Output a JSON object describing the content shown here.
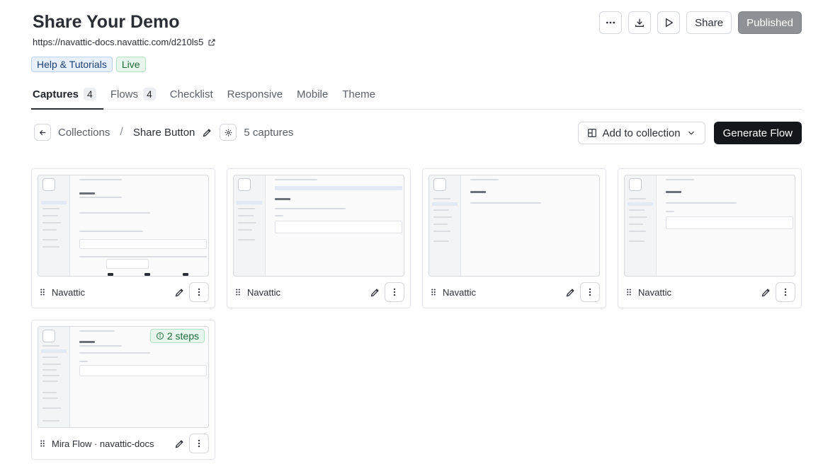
{
  "header": {
    "title": "Share Your Demo",
    "url": "https://navattic-docs.navattic.com/d210ls5",
    "tags": [
      "Help & Tutorials",
      "Live"
    ]
  },
  "actions": {
    "more_icon": "more-horizontal-icon",
    "download_icon": "download-icon",
    "play_icon": "play-icon",
    "share_label": "Share",
    "published_label": "Published"
  },
  "tabs": [
    {
      "label": "Captures",
      "count": "4",
      "active": true
    },
    {
      "label": "Flows",
      "count": "4"
    },
    {
      "label": "Checklist"
    },
    {
      "label": "Responsive"
    },
    {
      "label": "Mobile"
    },
    {
      "label": "Theme"
    }
  ],
  "breadcrumb": {
    "parent": "Collections",
    "separator": "/",
    "current": "Share Button",
    "captures_count": "5 captures"
  },
  "toolbar": {
    "add_to_collection": "Add to collection",
    "generate_flow": "Generate Flow"
  },
  "cards": [
    {
      "name": "Navattic"
    },
    {
      "name": "Navattic"
    },
    {
      "name": "Navattic"
    },
    {
      "name": "Navattic"
    },
    {
      "name": "Mira Flow · navattic-docs",
      "badge": "2 steps"
    }
  ],
  "colors": {
    "primary_button": "#13171c",
    "published_button": "#8e9196",
    "tag_blue": "#e8f1fb",
    "tag_green": "#e6f6ec"
  }
}
